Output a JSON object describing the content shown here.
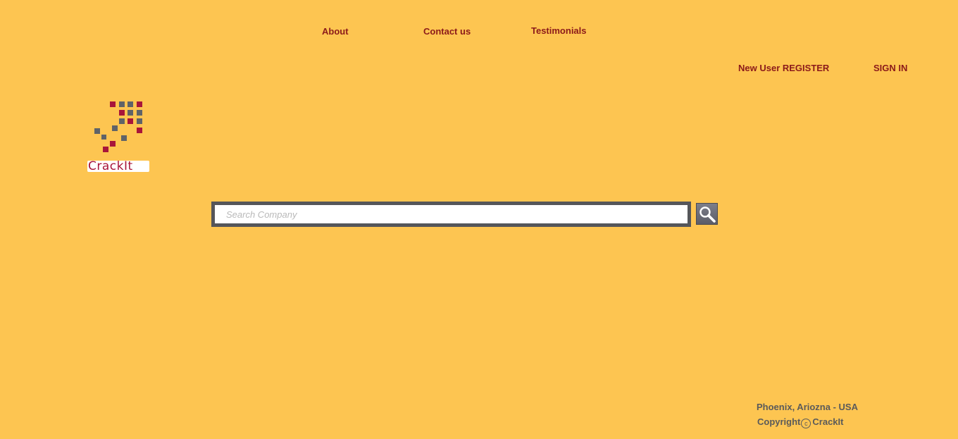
{
  "nav": {
    "about": "About",
    "contact": "Contact us",
    "testimonials": "Testimonials"
  },
  "auth": {
    "register": "New User REGISTER",
    "signin": "SIGN IN"
  },
  "logo": {
    "text": "CrackIt"
  },
  "search": {
    "placeholder": "Search Company",
    "value": "",
    "icon": "search-icon"
  },
  "footer": {
    "location": "Phoenix, Ariozna - USA",
    "copyright_prefix": "Copyright",
    "copyright_symbol": "c",
    "copyright_name": "CrackIt"
  },
  "colors": {
    "background": "#FDC551",
    "link": "#8B1A1A",
    "logo_red": "#A8153A",
    "logo_gray": "#5F6368",
    "search_border": "#55565A",
    "footer_text": "#5A5A5A"
  }
}
